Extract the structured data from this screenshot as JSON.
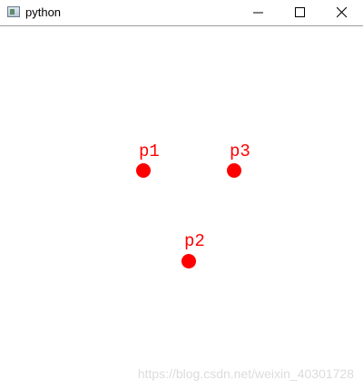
{
  "window": {
    "title": "python",
    "icon": "python-window-icon"
  },
  "controls": {
    "minimize_icon": "minimize-icon",
    "maximize_icon": "maximize-icon",
    "close_icon": "close-icon"
  },
  "canvas": {
    "point_color": "#ff0000",
    "points": [
      {
        "label": "p1"
      },
      {
        "label": "p2"
      },
      {
        "label": "p3"
      }
    ]
  },
  "watermark": {
    "text": "https://blog.csdn.net/weixin_40301728"
  }
}
